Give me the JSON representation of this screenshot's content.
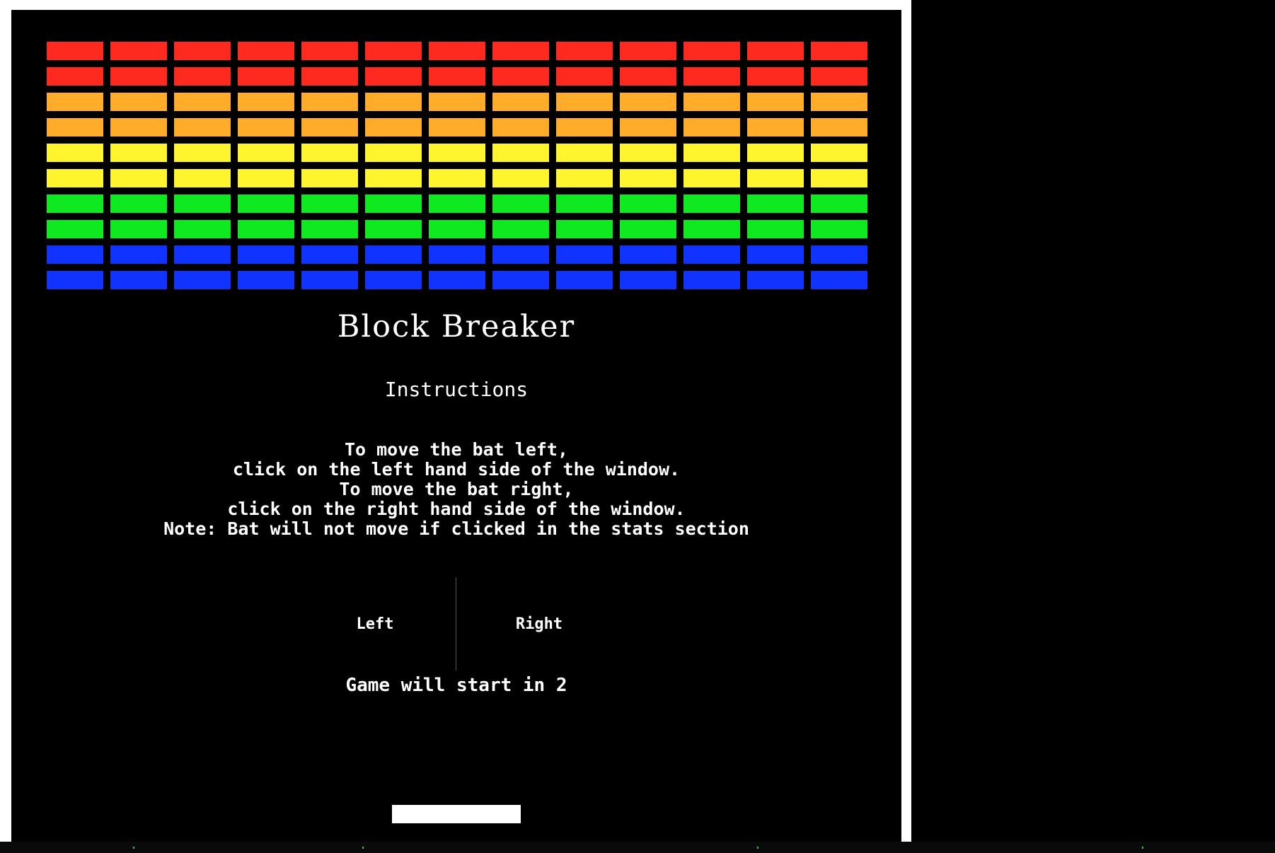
{
  "game": {
    "title": "Block Breaker",
    "subtitle": "Instructions",
    "instructions": [
      "To move the bat left,",
      "click on the left hand side of the window.",
      "To move the bat right,",
      "click on the right hand side of the window.",
      "Note: Bat will not move if clicked in the stats section"
    ],
    "controls": {
      "left_label": "Left",
      "right_label": "Right"
    },
    "countdown_text": "Game will start in 2"
  },
  "bricks": {
    "columns": 13,
    "row_colors": [
      "#ff2a1f",
      "#ff2a1f",
      "#ffac2a",
      "#ffac2a",
      "#fff52e",
      "#fff52e",
      "#0eea1f",
      "#0eea1f",
      "#1133ff",
      "#1133ff"
    ]
  },
  "colors": {
    "background": "#000000",
    "frame": "#ffffff",
    "text": "#ffffff",
    "bat": "#ffffff"
  }
}
